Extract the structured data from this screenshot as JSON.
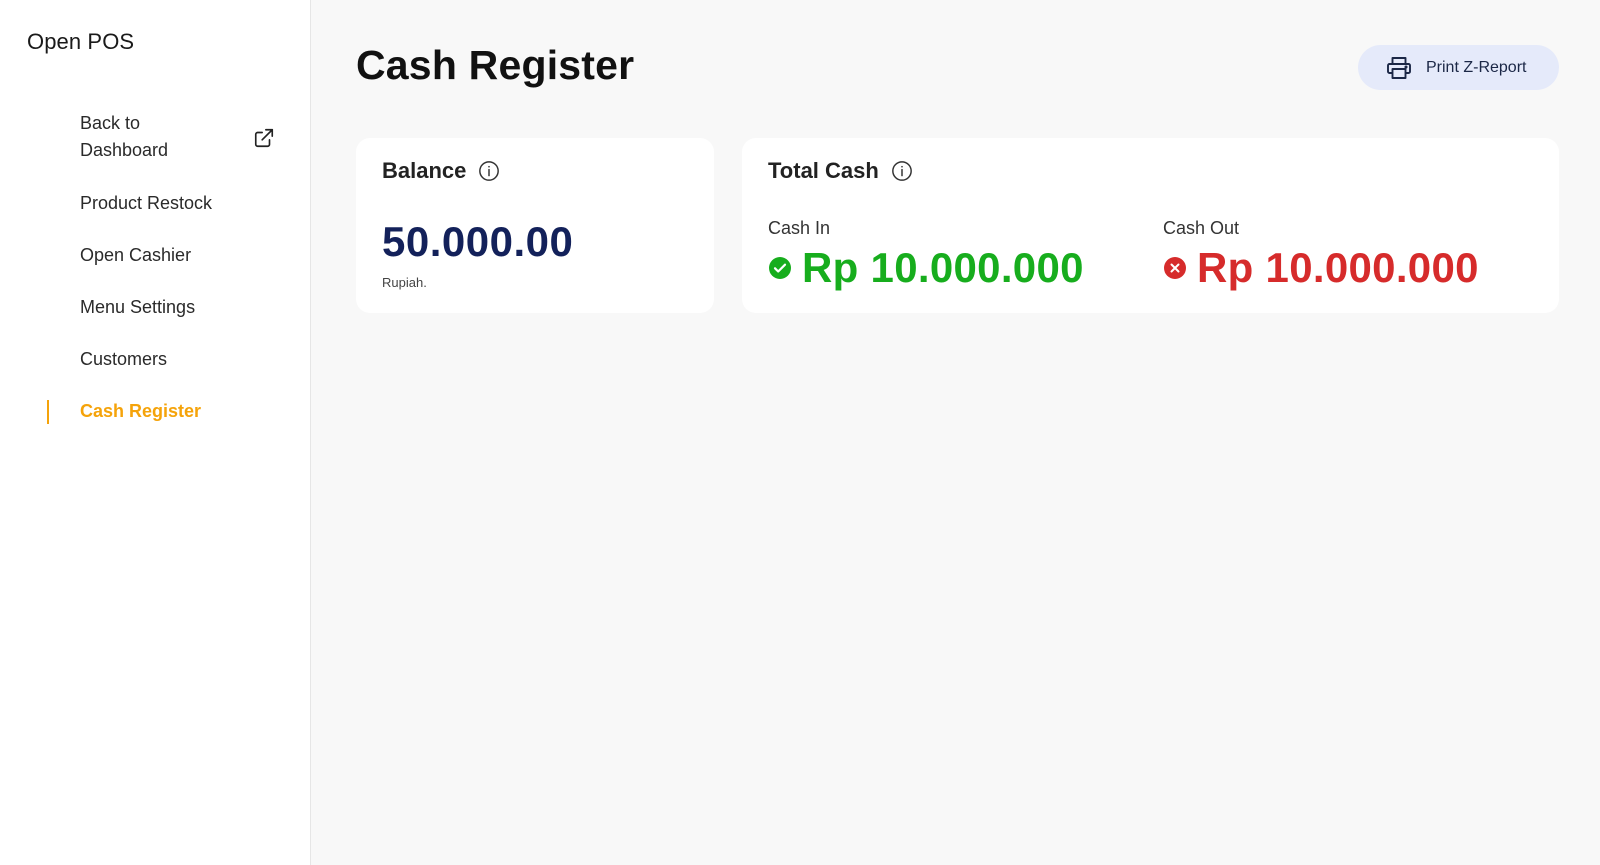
{
  "app": {
    "name": "Open POS"
  },
  "sidebar": {
    "items": [
      {
        "label": "Back to Dashboard",
        "icon": "external-link-icon"
      },
      {
        "label": "Product Restock"
      },
      {
        "label": "Open Cashier"
      },
      {
        "label": "Menu Settings"
      },
      {
        "label": "Customers"
      },
      {
        "label": "Cash Register",
        "active": true
      }
    ]
  },
  "header": {
    "title": "Cash Register",
    "print_button": {
      "label": "Print Z-Report",
      "icon": "printer-icon"
    }
  },
  "balance_card": {
    "title": "Balance",
    "value": "50.000.00",
    "unit": "Rupiah.",
    "icon": "info-icon"
  },
  "total_cash_card": {
    "title": "Total Cash",
    "icon": "info-icon",
    "cash_in": {
      "label": "Cash In",
      "amount": "Rp 10.000.000",
      "icon": "check-circle-icon"
    },
    "cash_out": {
      "label": "Cash Out",
      "amount": "Rp 10.000.000",
      "icon": "x-circle-icon"
    }
  },
  "colors": {
    "accent_active": "#f5a30a",
    "balance_value": "#13215a",
    "cash_in": "#17ad1d",
    "cash_out": "#d62b2b",
    "print_button_bg": "#e5eafa"
  }
}
